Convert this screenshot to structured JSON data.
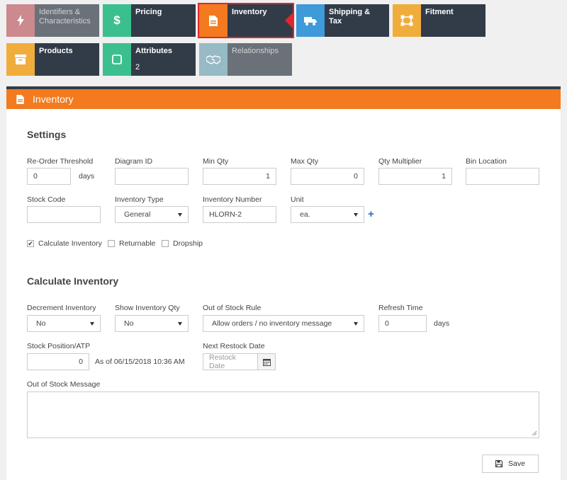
{
  "tabs": [
    {
      "label": "Identifiers & Characteristics",
      "icon": "bolt-icon",
      "color": "#c0676e"
    },
    {
      "label": "Pricing",
      "icon": "dollar-icon",
      "color": "#3cbf8e"
    },
    {
      "label": "Inventory",
      "icon": "document-icon",
      "color": "#f37a1f"
    },
    {
      "label": "Shipping & Tax",
      "icon": "truck-icon",
      "color": "#3f9ad9"
    },
    {
      "label": "Fitment",
      "icon": "vector-icon",
      "color": "#f0ad3c"
    },
    {
      "label": "Products",
      "icon": "box-icon",
      "color": "#f0ad3c"
    },
    {
      "label": "Attributes",
      "sublabel": "2",
      "icon": "square-icon",
      "color": "#3cbf8e"
    },
    {
      "label": "Relationships",
      "icon": "handshake-icon",
      "color": "#78a8b8"
    }
  ],
  "panel": {
    "title": "Inventory",
    "settings": {
      "title": "Settings",
      "reorder_threshold": {
        "label": "Re-Order Threshold",
        "value": "0",
        "unit": "days"
      },
      "diagram_id": {
        "label": "Diagram ID",
        "value": ""
      },
      "min_qty": {
        "label": "Min Qty",
        "value": "1"
      },
      "max_qty": {
        "label": "Max Qty",
        "value": "0"
      },
      "qty_multiplier": {
        "label": "Qty Multiplier",
        "value": "1"
      },
      "bin_location": {
        "label": "Bin Location",
        "value": ""
      },
      "stock_code": {
        "label": "Stock Code",
        "value": ""
      },
      "inventory_type": {
        "label": "Inventory Type",
        "value": "General"
      },
      "inventory_number": {
        "label": "Inventory Number",
        "value": "HLORN-2"
      },
      "unit": {
        "label": "Unit",
        "value": "ea."
      },
      "checkboxes": {
        "calculate": {
          "label": "Calculate Inventory",
          "checked": true
        },
        "returnable": {
          "label": "Returnable",
          "checked": false
        },
        "dropship": {
          "label": "Dropship",
          "checked": false
        }
      }
    },
    "calc": {
      "title": "Calculate Inventory",
      "decrement": {
        "label": "Decrement Inventory",
        "value": "No"
      },
      "show_qty": {
        "label": "Show Inventory Qty",
        "value": "No"
      },
      "oos_rule": {
        "label": "Out of Stock Rule",
        "value": "Allow orders / no inventory message"
      },
      "refresh": {
        "label": "Refresh Time",
        "value": "0",
        "unit": "days"
      },
      "stock_position": {
        "label": "Stock Position/ATP",
        "value": "0",
        "as_of": "As of 06/15/2018 10:36 AM"
      },
      "restock": {
        "label": "Next Restock Date",
        "placeholder": "Restock Date"
      },
      "oos_message": {
        "label": "Out of Stock Message",
        "value": ""
      }
    },
    "save_label": "Save"
  }
}
